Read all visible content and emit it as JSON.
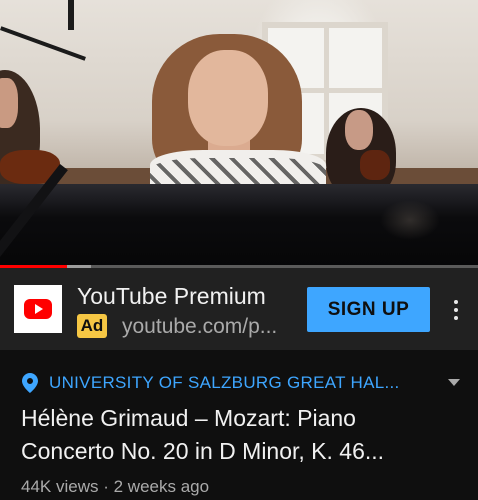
{
  "player": {
    "progress_fraction": 0.14,
    "buffer_fraction": 0.19,
    "colors": {
      "progress": "#ff0000",
      "buffer": "#9c9c9c",
      "track": "#5a5a5a"
    }
  },
  "ad": {
    "logo_icon": "youtube-logo-icon",
    "title": "YouTube Premium",
    "badge": "Ad",
    "url": "youtube.com/p...",
    "cta_label": "SIGN UP",
    "menu_icon": "more-vert-icon",
    "colors": {
      "cta": "#3ea6ff",
      "badge": "#f6c744",
      "brand": "#ff0000"
    }
  },
  "video": {
    "location_icon": "location-pin-icon",
    "location": "UNIVERSITY OF SALZBURG GREAT HAL...",
    "expand_icon": "chevron-down-icon",
    "title_line1": "Hélène Grimaud – Mozart: Piano",
    "title_line2": "Concerto No. 20 in D Minor, K. 46...",
    "views": "44K views",
    "separator": "·",
    "age": "2 weeks ago",
    "colors": {
      "location": "#3ea6ff"
    }
  }
}
